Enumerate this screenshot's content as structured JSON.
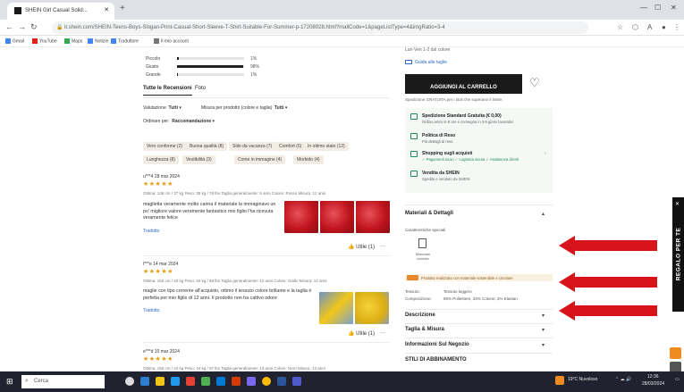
{
  "browser": {
    "tab_title": "SHEIN Girl Casual Solid...",
    "url": "it.shein.com/SHEIN-Teens-Boys-Slogan-Print-Casual-Short-Sleeve-T-Shirt-Suitable-For-Summer-p-17208028.html?mallCode=1&pageListType=4&imgRatio=3-4",
    "bookmarks": [
      "Gmail",
      "YouTube",
      "Maps",
      "Notizie",
      "Traduttore",
      "Il mio account",
      "Shopping"
    ]
  },
  "ratings": {
    "rows": [
      {
        "label": "Piccolo",
        "pct": "1%",
        "fill": 0.02
      },
      {
        "label": "Giusto",
        "pct": "98%",
        "fill": 0.98
      },
      {
        "label": "Grande",
        "pct": "1%",
        "fill": 0.01
      }
    ]
  },
  "review_tabs": [
    "Tutte le Recensioni",
    "Foto"
  ],
  "filters": {
    "row1": [
      {
        "label": "Valutazione",
        "value": "Tutti"
      },
      {
        "label": "Misura per prodotto (colore e taglia)",
        "value": "Tutti"
      }
    ],
    "sort_label": "Ordinare per:",
    "sort_value": "Raccomandazione"
  },
  "chips_row1": [
    "Vero conforme (2)",
    "Buona qualità (8)",
    "Stile da vacanza (7)",
    "Comfort (6)",
    "In ottimo stato (12)"
  ],
  "chips_row2": [
    "Lunghezza (8)",
    "Vestibilità (3)",
    "Come in immagine (4)",
    "Morbido (4)"
  ],
  "reviews": [
    {
      "user": "u***4  28 mar 2024",
      "stars": "★★★★★",
      "meta": "Ottima: 146 cm / 37 kg   Peso: 35 kg / 78 lbs   Taglia generalmente: 9 anni   Colore: Rosso   Misura: 12 anni",
      "text": "maglietta veramente molto carina il materiale la immaginavo un po' migliore valore veramente fantastico mio figlio l'ha ricevuta veramente felice",
      "more": "Tradotto",
      "helpful": "Utile (1)",
      "photos": [
        "red",
        "red",
        "red"
      ]
    },
    {
      "user": "l***e  14 mar 2024",
      "stars": "★★★★★",
      "meta": "Ottima: 152 cm / 40 kg   Peso: 40 kg / 88 lbs   Taglia generalmente: 12 anni   Colore: Giallo   Misura: 12 anni",
      "text": "maglie con tipo corrente all'acquisto, ottimo il tessuto colore brillante e la taglia è perfetta per mio figlio di 12 anni. Il prodotto non ha cattivo odore",
      "more": "Tradotto",
      "helpful": "Utile (1)",
      "photos": [
        "blue",
        "yellow"
      ]
    },
    {
      "user": "e***d  10 mar 2024",
      "stars": "★★★★★",
      "meta": "Ottima: 155 cm / 44 kg   Peso: 44 kg / 97 lbs   Taglia generalmente: 13 anni   Colore: Nero   Misura: 13 anni"
    }
  ],
  "product": {
    "price_note": "Lun-Ven 1-2 dal colore",
    "size_link": "Guida alle taglie",
    "cart_button": "AGGIUNGI AL CARRELLO",
    "ship_note": "Spedizione GRATUITA per i titoli che superano il limite.",
    "benefits": [
      {
        "title": "Spedizione Standard Gratuita (€ 0,00)",
        "sub": "Ordina entro le 8 ore e consegna in 3-5 giorni lavorativi",
        "green": false
      },
      {
        "title": "Politica di Reso",
        "sub": "Più dettagli di reso",
        "green": false
      },
      {
        "title": "Shopping sugli acquisti",
        "sub": "✓ Pagamenti sicuri  ✓ Logistica sicura  ✓ Assistenza clienti",
        "green": true
      },
      {
        "title": "Vendita da SHEIN",
        "sub": "Spedito e venduto da SHEIN",
        "green": false
      }
    ],
    "materials_title": "Materiali & Dettagli",
    "sustain_title": "Caratteristiche speciali",
    "sustain_label": "Materiale riciclato",
    "promo": "Prodotto realizzato con materiale sostenibile e circolare",
    "attributes": [
      {
        "k": "Tessuto:",
        "v": "Tessuto leggero"
      },
      {
        "k": "Composizione:",
        "v": "65% Poliestere, 33% Cotone, 2% Elastan"
      }
    ],
    "sections": [
      "Descrizione",
      "Taglia & Misura",
      "Informazioni Sul Negozio",
      "STILI DI ABBINAMENTO"
    ]
  },
  "gift_tab": "REGALO PER TE",
  "taskbar": {
    "search": "Cerca",
    "tray_weather": "19°C  Nuvoloso",
    "time": "12:36",
    "date": "28/03/2024"
  }
}
